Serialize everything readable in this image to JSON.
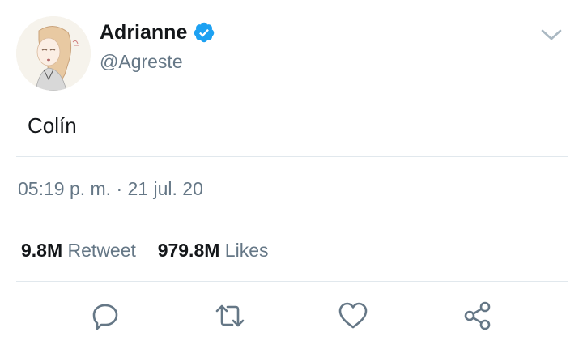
{
  "user": {
    "display_name": "Adrianne",
    "handle": "@Agreste",
    "verified": true
  },
  "tweet": {
    "text": "Colín",
    "timestamp": "05:19 p. m. · 21 jul. 20"
  },
  "stats": {
    "retweets_count": "9.8M",
    "retweets_label": "Retweet",
    "likes_count": "979.8M",
    "likes_label": "Likes"
  },
  "colors": {
    "verified_blue": "#1da1f2",
    "secondary_text": "#657786",
    "icon_gray": "#657786"
  },
  "icons": {
    "menu": "chevron-down-icon",
    "reply": "reply-icon",
    "retweet": "retweet-icon",
    "like": "heart-icon",
    "share": "share-icon"
  }
}
